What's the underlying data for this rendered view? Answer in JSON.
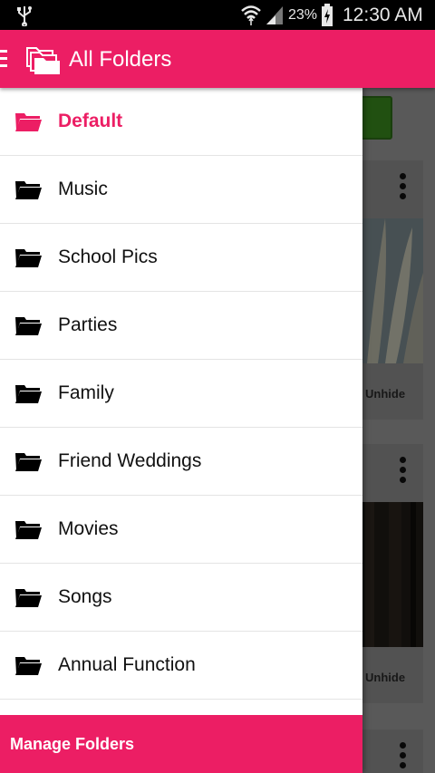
{
  "status_bar": {
    "battery_percent": "23%",
    "time": "12:30 AM",
    "icons": [
      "usb-icon",
      "wifi-icon",
      "signal-icon",
      "battery-charging-icon"
    ]
  },
  "app_bar": {
    "title": "All Folders",
    "accent_color": "#ec1e64"
  },
  "drawer": {
    "folders": [
      {
        "label": "Default",
        "active": true
      },
      {
        "label": "Music",
        "active": false
      },
      {
        "label": "School Pics",
        "active": false
      },
      {
        "label": "Parties",
        "active": false
      },
      {
        "label": "Family",
        "active": false
      },
      {
        "label": "Friend Weddings",
        "active": false
      },
      {
        "label": "Movies",
        "active": false
      },
      {
        "label": "Songs",
        "active": false
      },
      {
        "label": "Annual Function",
        "active": false
      }
    ],
    "manage_label": "Manage Folders"
  },
  "background": {
    "cards": [
      {
        "action_label": "Unhide"
      },
      {
        "action_label": "Unhide"
      }
    ]
  }
}
